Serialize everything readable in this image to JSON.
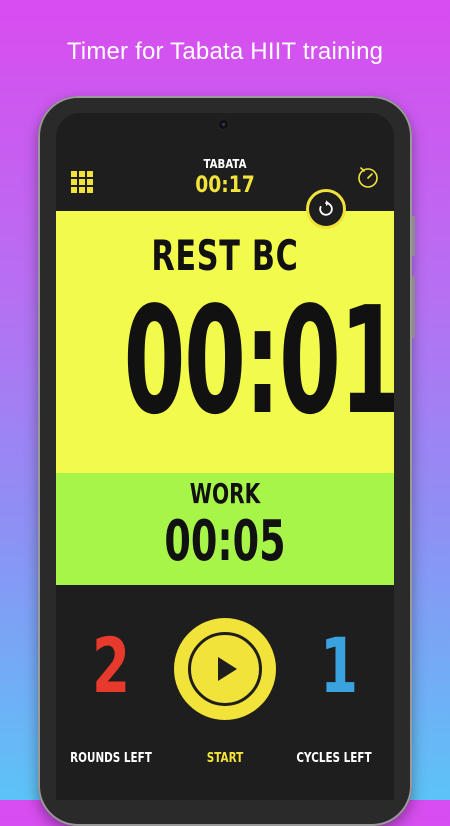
{
  "promo": {
    "title": "Timer for Tabata HIIT training"
  },
  "header": {
    "mode_label": "TABATA",
    "total_time": "00:17"
  },
  "icons": {
    "menu": "grid-menu-icon",
    "timer": "stopwatch-icon",
    "reset": "reset-icon",
    "play": "play-icon"
  },
  "current_phase": {
    "label": "REST BC",
    "time": "00:01"
  },
  "next_phase": {
    "label": "WORK",
    "time": "00:05"
  },
  "controls": {
    "rounds_left": "2",
    "rounds_label": "ROUNDS LEFT",
    "start_label": "START",
    "cycles_left": "1",
    "cycles_label": "CYCLES LEFT"
  },
  "colors": {
    "accent": "#f2e33a",
    "rest_bg": "#f2fa4c",
    "work_bg": "#a8f54a",
    "rounds": "#e83a2c",
    "cycles": "#3aa3df",
    "dark": "#1e1e1e"
  }
}
